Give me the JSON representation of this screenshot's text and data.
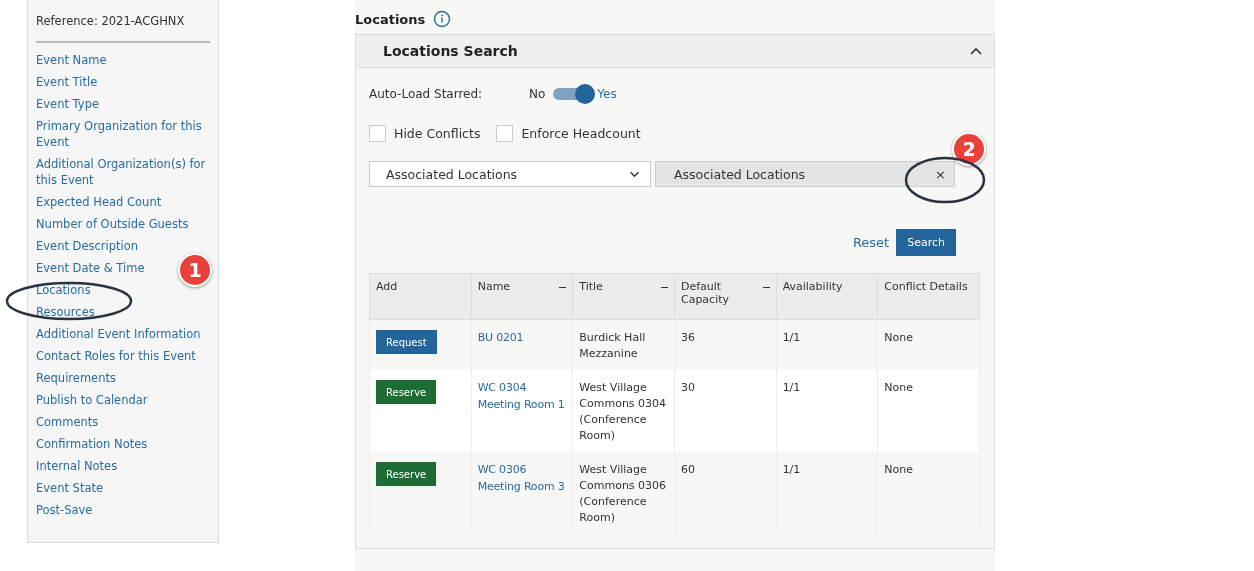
{
  "sidebar": {
    "reference": "Reference: 2021-ACGHNX",
    "items": [
      {
        "label": "Event Name"
      },
      {
        "label": "Event Title"
      },
      {
        "label": "Event Type"
      },
      {
        "label": "Primary Organization for this Event"
      },
      {
        "label": "Additional Organization(s) for this Event"
      },
      {
        "label": "Expected Head Count"
      },
      {
        "label": "Number of Outside Guests"
      },
      {
        "label": "Event Description"
      },
      {
        "label": "Event Date & Time"
      },
      {
        "label": "Locations"
      },
      {
        "label": "Resources"
      },
      {
        "label": "Additional Event Information"
      },
      {
        "label": "Contact Roles for this Event"
      },
      {
        "label": "Requirements"
      },
      {
        "label": "Publish to Calendar"
      },
      {
        "label": "Comments"
      },
      {
        "label": "Confirmation Notes"
      },
      {
        "label": "Internal Notes"
      },
      {
        "label": "Event State"
      },
      {
        "label": "Post-Save"
      }
    ]
  },
  "section_title": "Locations",
  "panel": {
    "title": "Locations Search",
    "auto_load": {
      "label": "Auto-Load Starred:",
      "off_label": "No",
      "on_label": "Yes",
      "on": true
    },
    "checkboxes": [
      {
        "label": "Hide Conflicts",
        "checked": false
      },
      {
        "label": "Enforce Headcount",
        "checked": false
      }
    ],
    "dropdown": {
      "value": "Associated Locations"
    },
    "filter_chip": {
      "value": "Associated Locations",
      "close": "×"
    },
    "reset": "Reset",
    "search": "Search",
    "table": {
      "columns": [
        {
          "label": "Add",
          "sortable": false
        },
        {
          "label": "Name",
          "sortable": true
        },
        {
          "label": "Title",
          "sortable": true
        },
        {
          "label": "Default Capacity",
          "sortable": true
        },
        {
          "label": "Availability",
          "sortable": false
        },
        {
          "label": "Conflict Details",
          "sortable": false
        }
      ],
      "rows": [
        {
          "action": "Request",
          "kind": "request",
          "name": [
            "BU 0201"
          ],
          "title": "Burdick Hall Mezzanine",
          "capacity": "36",
          "availability": "1/1",
          "conflict": "None"
        },
        {
          "action": "Reserve",
          "kind": "reserve",
          "name": [
            "WC 0304",
            "Meeting Room 1"
          ],
          "title": "West Village Commons 0304 (Conference Room)",
          "capacity": "30",
          "availability": "1/1",
          "conflict": "None"
        },
        {
          "action": "Reserve",
          "kind": "reserve",
          "name": [
            "WC 0306",
            "Meeting Room 3"
          ],
          "title": "West Village Commons 0306 (Conference Room)",
          "capacity": "60",
          "availability": "1/1",
          "conflict": "None"
        }
      ]
    }
  },
  "annotations": [
    {
      "number": "1"
    },
    {
      "number": "2"
    }
  ]
}
